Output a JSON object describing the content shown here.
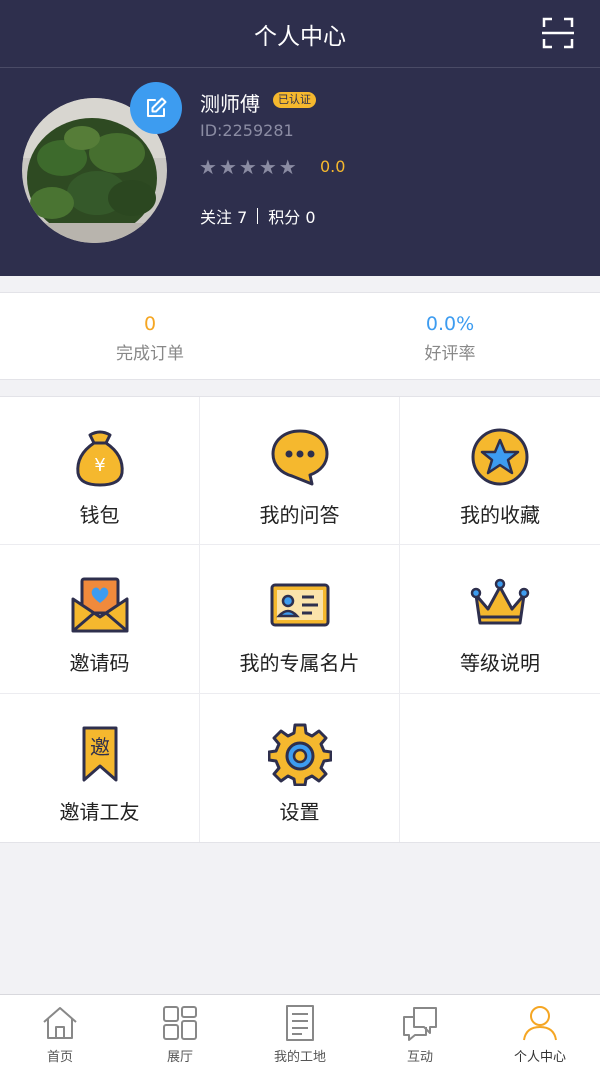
{
  "header": {
    "title": "个人中心"
  },
  "profile": {
    "name": "测师傅",
    "badge": "已认证",
    "id_text": "ID:2259281",
    "stars": 5,
    "rating": "0.0",
    "follow": "关注 7",
    "points": "积分 0"
  },
  "stats": [
    {
      "value": "0",
      "label": "完成订单",
      "color": "#f5a623"
    },
    {
      "value": "0.0%",
      "label": "好评率",
      "color": "#3d9cf0"
    }
  ],
  "menu": [
    {
      "label": "钱包",
      "icon": "money-bag-icon"
    },
    {
      "label": "我的问答",
      "icon": "chat-bubble-icon"
    },
    {
      "label": "我的收藏",
      "icon": "star-badge-icon"
    },
    {
      "label": "邀请码",
      "icon": "envelope-heart-icon"
    },
    {
      "label": "我的专属名片",
      "icon": "business-card-icon"
    },
    {
      "label": "等级说明",
      "icon": "crown-icon"
    },
    {
      "label": "邀请工友",
      "icon": "invite-ribbon-icon",
      "icon_text": "邀"
    },
    {
      "label": "设置",
      "icon": "gear-icon"
    }
  ],
  "tabs": [
    {
      "label": "首页",
      "icon": "home-icon"
    },
    {
      "label": "展厅",
      "icon": "gallery-icon"
    },
    {
      "label": "我的工地",
      "icon": "document-icon"
    },
    {
      "label": "互动",
      "icon": "chat-icon"
    },
    {
      "label": "个人中心",
      "icon": "person-icon",
      "active": true
    }
  ],
  "colors": {
    "navy": "#2e2f4d",
    "gold": "#f5b82e",
    "blue": "#3d9cf0",
    "active_tab": "#f5a623"
  }
}
